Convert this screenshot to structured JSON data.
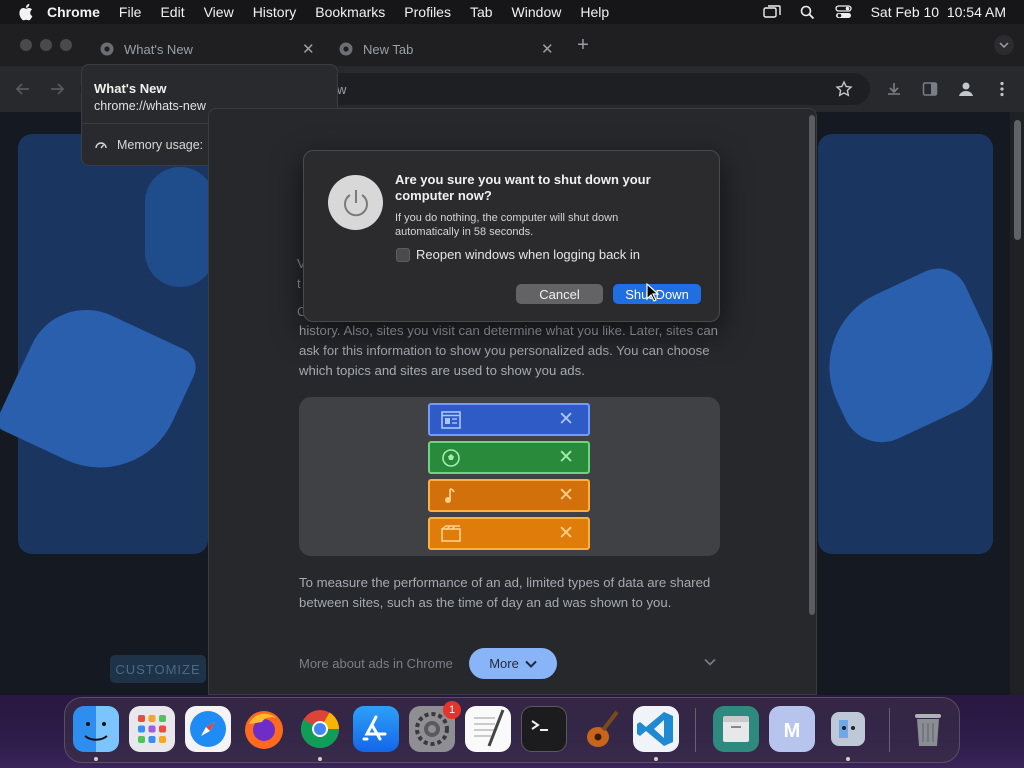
{
  "menubar": {
    "app": "Chrome",
    "items": [
      "File",
      "Edit",
      "View",
      "History",
      "Bookmarks",
      "Profiles",
      "Tab",
      "Window",
      "Help"
    ],
    "datetime": "Sat Feb 10  10:54 AM"
  },
  "tabs": [
    {
      "label": "What's New"
    },
    {
      "label": "New Tab"
    }
  ],
  "omnibox": {
    "partial": "w"
  },
  "hovercard": {
    "title": "What's New",
    "url": "chrome://whats-new",
    "memory": "Memory usage:"
  },
  "panel": {
    "partial_lines": [
      "V",
      "t",
      "C"
    ],
    "paragraph1": "history. Also, sites you visit can determine what you like. Later, sites can ask for this information to show you personalized ads. You can choose which topics and sites are used to show you ads.",
    "paragraph2": "To measure the performance of an ad, limited types of data are shared between sites, such as the time of day an ad was shown to you.",
    "more_about": "More about ads in Chrome",
    "more_button": "More",
    "illus_rows": [
      {
        "icon": "news-icon",
        "color": "#3b6ed8",
        "text_color": "#8fb4ff"
      },
      {
        "icon": "soccer-ball-icon",
        "color": "#2e8b3e",
        "text_color": "#8fe39c"
      },
      {
        "icon": "music-note-icon",
        "color": "#d97a10",
        "text_color": "#ffc36a"
      },
      {
        "icon": "film-icon",
        "color": "#e07d0a",
        "text_color": "#ffd07a"
      }
    ]
  },
  "customize": "CUSTOMIZE",
  "dialog": {
    "heading": "Are you sure you want to shut down your computer now?",
    "body": "If you do nothing, the computer will shut down automatically in 58 seconds.",
    "checkbox_label": "Reopen windows when logging back in",
    "cancel": "Cancel",
    "shutdown": "Shut Down"
  },
  "dock": {
    "apps": [
      "Finder",
      "Launchpad",
      "Safari",
      "Firefox",
      "Chrome",
      "App Store",
      "System Settings",
      "TextEdit",
      "Terminal",
      "GarageBand",
      "Visual Studio Code",
      "Files",
      "Mail",
      "Migration Assistant",
      "Trash"
    ],
    "badge": "1"
  }
}
